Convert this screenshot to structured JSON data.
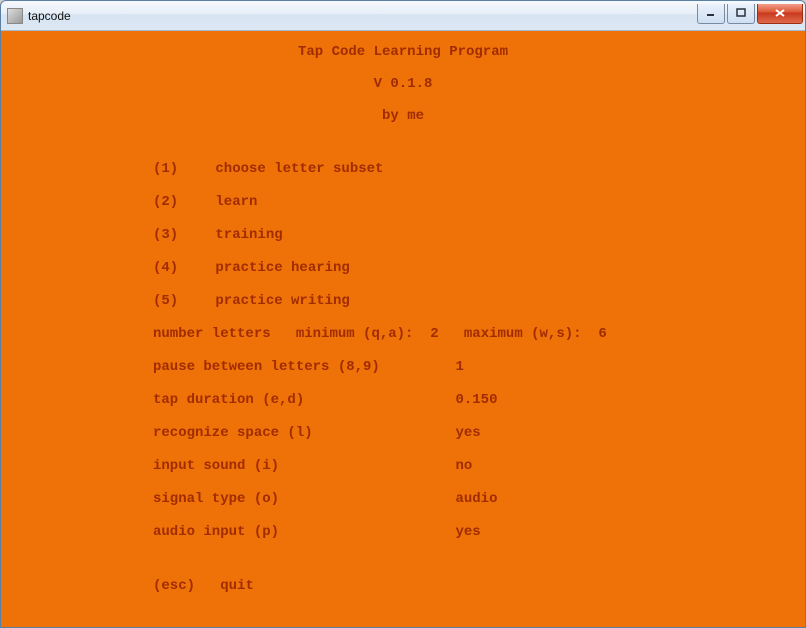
{
  "window": {
    "title": "tapcode"
  },
  "header": {
    "title": "Tap Code Learning Program",
    "version": "V 0.1.8",
    "author": "by me"
  },
  "menu": [
    {
      "key": "(1)",
      "label": "choose letter subset"
    },
    {
      "key": "(2)",
      "label": "learn"
    },
    {
      "key": "(3)",
      "label": "training"
    },
    {
      "key": "(4)",
      "label": "practice hearing"
    },
    {
      "key": "(5)",
      "label": "practice writing"
    }
  ],
  "settings": {
    "number_letters": {
      "label": "number letters",
      "min_label": "minimum (q,a):",
      "min_value": "2",
      "max_label": "maximum (w,s):",
      "max_value": "6"
    },
    "pause": {
      "label": "pause between letters (8,9)",
      "value": "1"
    },
    "tap_duration": {
      "label": "tap duration (e,d)",
      "value": "0.150"
    },
    "recognize_space": {
      "label": "recognize space (l)",
      "value": "yes"
    },
    "input_sound": {
      "label": "input sound (i)",
      "value": "no"
    },
    "signal_type": {
      "label": "signal type (o)",
      "value": "audio"
    },
    "audio_input": {
      "label": "audio input (p)",
      "value": "yes"
    }
  },
  "quit": {
    "key": "(esc)",
    "label": "quit"
  }
}
